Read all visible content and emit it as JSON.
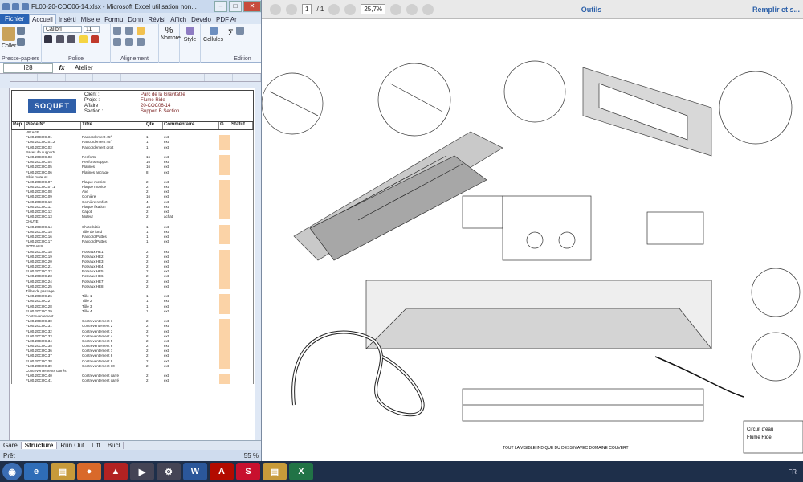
{
  "excel": {
    "title": "FL00-20-COC06-14.xlsx - Microsoft Excel utilisation non...",
    "tabs": [
      "Fichier",
      "Accueil",
      "Insérti",
      "Mise e",
      "Formu",
      "Donn",
      "Révisi",
      "Affich",
      "Dévelo",
      "PDF Ar"
    ],
    "ribbon": {
      "paste": "Coller",
      "font_name": "Calibri",
      "font_size": "11",
      "number": "Nombre",
      "style": "Style",
      "cells": "Cellules",
      "groups": [
        "Presse-papiers",
        "Police",
        "Alignement",
        "Edition"
      ]
    },
    "formula_bar": {
      "name_box": "I28",
      "fx": "fx",
      "value": "Atelier"
    },
    "sheet_header": {
      "company": "SOQUET",
      "labels": [
        "Client :",
        "Projet :",
        "Affaire :",
        "Section :"
      ],
      "values": [
        "Parc de la Gravitatile",
        "Flume Ride",
        "20-COC06-14",
        "Support B   Section"
      ],
      "columns": [
        "Rep",
        "Pièce N°",
        "Titre",
        "Qté",
        "Commentaire",
        "G",
        "Statut"
      ]
    },
    "rows": [
      {
        "sec": true,
        "a": "VIRAGE",
        "b": "",
        "c": "",
        "d": ""
      },
      {
        "a": "FL00.20COC.01",
        "b": "Raccordement 45°",
        "c": "1",
        "d": "ext"
      },
      {
        "a": "FL00.20COC.01.2",
        "b": "Raccordement 45°",
        "c": "1",
        "d": "ext"
      },
      {
        "a": "FL00.20COC.02",
        "b": "Raccordement droit",
        "c": "1",
        "d": "ext"
      },
      {
        "sec": true,
        "a": "Bases de supports",
        "b": "",
        "c": "",
        "d": ""
      },
      {
        "a": "FL00.20COC.03",
        "b": "Renforts",
        "c": "16",
        "d": "ext"
      },
      {
        "a": "FL00.20COC.04",
        "b": "Renforts support",
        "c": "16",
        "d": "ext"
      },
      {
        "a": "FL00.20COC.05",
        "b": "Platines",
        "c": "16",
        "d": "ext"
      },
      {
        "a": "FL00.20COC.06",
        "b": "Platines ancrage",
        "c": "8",
        "d": "ext"
      },
      {
        "sec": true,
        "a": "Bâtis moteurs",
        "b": "",
        "c": "",
        "d": ""
      },
      {
        "a": "FL00.20COC.07",
        "b": "Plaque motrice",
        "c": "2",
        "d": "ext"
      },
      {
        "a": "FL00.20COC.07.1",
        "b": "Plaque motrice",
        "c": "2",
        "d": "ext"
      },
      {
        "a": "FL00.20COC.08",
        "b": "Axe",
        "c": "2",
        "d": "ext"
      },
      {
        "a": "FL00.20COC.09",
        "b": "Cornière",
        "c": "16",
        "d": "ext"
      },
      {
        "a": "FL00.20COC.10",
        "b": "Cornière renfort",
        "c": "4",
        "d": "ext"
      },
      {
        "a": "FL00.20COC.11",
        "b": "Plaque fixation",
        "c": "16",
        "d": "ext"
      },
      {
        "a": "FL00.20COC.12",
        "b": "Capot",
        "c": "2",
        "d": "ext"
      },
      {
        "a": "FL00.20COC.13",
        "b": "Moteur",
        "c": "2",
        "d": "achat"
      },
      {
        "sec": true,
        "a": "CHUTE",
        "b": "",
        "c": "",
        "d": ""
      },
      {
        "a": "FL00.20COC.14",
        "b": "Chute bâtie",
        "c": "1",
        "d": "ext"
      },
      {
        "a": "FL00.20COC.15",
        "b": "Tôle de fond",
        "c": "1",
        "d": "ext"
      },
      {
        "a": "FL00.20COC.16",
        "b": "Raccord Pattes",
        "c": "1",
        "d": "ext"
      },
      {
        "a": "FL00.20COC.17",
        "b": "Raccord Pattes",
        "c": "1",
        "d": "ext"
      },
      {
        "sec": true,
        "a": "POTEAUX",
        "b": "",
        "c": "",
        "d": ""
      },
      {
        "a": "FL00.20COC.18",
        "b": "Poteaux HE1",
        "c": "2",
        "d": "ext"
      },
      {
        "a": "FL00.20COC.19",
        "b": "Poteaux HE2",
        "c": "2",
        "d": "ext"
      },
      {
        "a": "FL00.20COC.20",
        "b": "Poteaux HE3",
        "c": "2",
        "d": "ext"
      },
      {
        "a": "FL00.20COC.21",
        "b": "Poteaux HE4",
        "c": "2",
        "d": "ext"
      },
      {
        "a": "FL00.20COC.22",
        "b": "Poteaux HE5",
        "c": "2",
        "d": "ext"
      },
      {
        "a": "FL00.20COC.23",
        "b": "Poteaux HE6",
        "c": "2",
        "d": "ext"
      },
      {
        "a": "FL00.20COC.24",
        "b": "Poteaux HE7",
        "c": "2",
        "d": "ext"
      },
      {
        "a": "FL00.20COC.25",
        "b": "Poteaux HE8",
        "c": "2",
        "d": "ext"
      },
      {
        "sec": true,
        "a": "Tôles de passage",
        "b": "",
        "c": "",
        "d": ""
      },
      {
        "a": "FL00.20COC.26",
        "b": "Tôle 1",
        "c": "1",
        "d": "ext"
      },
      {
        "a": "FL00.20COC.27",
        "b": "Tôle 2",
        "c": "1",
        "d": "ext"
      },
      {
        "a": "FL00.20COC.28",
        "b": "Tôle 3",
        "c": "1",
        "d": "ext"
      },
      {
        "a": "FL00.20COC.29",
        "b": "Tôle 4",
        "c": "1",
        "d": "ext"
      },
      {
        "sec": true,
        "a": "Contreventement",
        "b": "",
        "c": "",
        "d": ""
      },
      {
        "a": "FL00.20COC.30",
        "b": "Contreventement 1",
        "c": "2",
        "d": "ext"
      },
      {
        "a": "FL00.20COC.31",
        "b": "Contreventement 2",
        "c": "2",
        "d": "ext"
      },
      {
        "a": "FL00.20COC.32",
        "b": "Contreventement 3",
        "c": "2",
        "d": "ext"
      },
      {
        "a": "FL00.20COC.33",
        "b": "Contreventement 4",
        "c": "2",
        "d": "ext"
      },
      {
        "a": "FL00.20COC.34",
        "b": "Contreventement 5",
        "c": "2",
        "d": "ext"
      },
      {
        "a": "FL00.20COC.35",
        "b": "Contreventement 6",
        "c": "2",
        "d": "ext"
      },
      {
        "a": "FL00.20COC.36",
        "b": "Contreventement 7",
        "c": "2",
        "d": "ext"
      },
      {
        "a": "FL00.20COC.37",
        "b": "Contreventement 8",
        "c": "2",
        "d": "ext"
      },
      {
        "a": "FL00.20COC.38",
        "b": "Contreventement 9",
        "c": "2",
        "d": "ext"
      },
      {
        "a": "FL00.20COC.39",
        "b": "Contreventement 10",
        "c": "2",
        "d": "ext"
      },
      {
        "sec": true,
        "a": "Contreventements carrés",
        "b": "",
        "c": "",
        "d": ""
      },
      {
        "a": "FL00.20COC.40",
        "b": "Contreventement carré",
        "c": "2",
        "d": "ext"
      },
      {
        "a": "FL00.20COC.41",
        "b": "Contreventement carré",
        "c": "2",
        "d": "ext"
      }
    ],
    "sheet_tabs": [
      "Gare",
      "Structure",
      "Run Out",
      "Lift",
      "Bucl"
    ],
    "status": {
      "ready": "Prêt",
      "zoom": "55 %"
    }
  },
  "pdf": {
    "page": "1",
    "page_total": "/ 1",
    "zoom": "25,7%",
    "tools": "Outils",
    "fill_sign": "Remplir et s...",
    "drawing_title": "Circuit d'eau",
    "drawing_sub": "Flume Ride",
    "caption": "TOUT LA VISIBLE INDIQUE DU DESSIN AVEC DOMAINE COUVERT"
  },
  "taskbar": {
    "time": "FR",
    "icons": [
      "start-orb",
      "ie",
      "explorer",
      "firefox",
      "autocad",
      "media",
      "settings",
      "word",
      "acrobat",
      "solidworks",
      "explorer2",
      "excel"
    ]
  }
}
